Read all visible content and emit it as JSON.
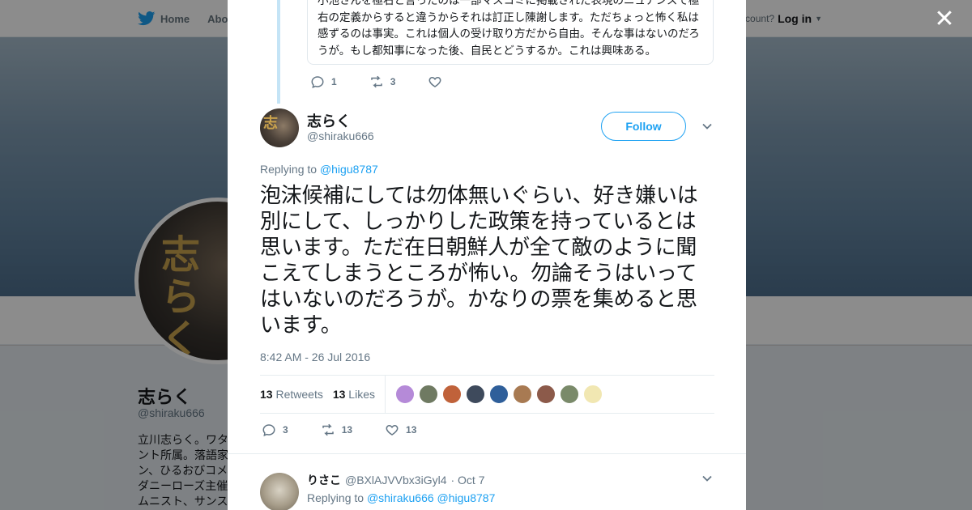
{
  "nav": {
    "home_label": "Home",
    "about_label": "Abo",
    "account_prompt": "ccount?",
    "login_label": "Log in"
  },
  "profile": {
    "name": "志らく",
    "handle": "@shiraku666",
    "bio": "立川志らく。ワタ\nント所属。落語家\nン、ひるおびコメ\nダニーローズ主催\nムニスト、サンス"
  },
  "parent_tweet": {
    "text": "小池さんを極右と言ったのは一部マスコミに掲載された表現のニュアンスで極右の定義からすると違うからそれは訂正し陳謝します。ただちょっと怖く私は感ずるのは事実。これは個人の受け取り方だから自由。そんな事はないのだろうが。もし都知事になった後、自民とどうするか。これは興味ある。",
    "replies": "1",
    "retweets": "3",
    "likes": ""
  },
  "tweet": {
    "author_name": "志らく",
    "author_handle": "@shiraku666",
    "follow_label": "Follow",
    "replying_prefix": "Replying to",
    "replying_to": "@higu8787",
    "text": "泡沫候補にしては勿体無いぐらい、好き嫌いは別にして、しっかりした政策を持っているとは思います。ただ在日朝鮮人が全て敵のように聞こえてしまうところが怖い。勿論そうはいってはいないのだろうが。かなりの票を集めると思います。",
    "timestamp": "8:42 AM - 26 Jul 2016",
    "retweet_count": "13",
    "retweet_label": "Retweets",
    "like_count": "13",
    "like_label": "Likes",
    "replies": "3",
    "retweets": "13",
    "likes": "13"
  },
  "likers": [
    {
      "color": "#b58ad8",
      "icon": "liker-avatar"
    },
    {
      "color": "#6f7a62",
      "icon": "liker-avatar"
    },
    {
      "color": "#c0623a",
      "icon": "liker-avatar"
    },
    {
      "color": "#3e4a5c",
      "icon": "liker-avatar"
    },
    {
      "color": "#2f5f9a",
      "icon": "liker-avatar"
    },
    {
      "color": "#a87a52",
      "icon": "liker-avatar"
    },
    {
      "color": "#8c5a4a",
      "icon": "liker-avatar"
    },
    {
      "color": "#7a8a6a",
      "icon": "liker-avatar"
    },
    {
      "color": "#f1e7b2",
      "icon": "liker-avatar"
    }
  ],
  "reply": {
    "name": "りさこ",
    "handle": "@BXlAJVVbx3iGyl4",
    "time": "· Oct 7",
    "replying_prefix": "Replying to",
    "mention_1": "@shiraku666",
    "mention_2": "@higu8787"
  },
  "colors": {
    "accent": "#1da1f2",
    "muted": "#657786",
    "thread_line": "#c4e4f6"
  }
}
